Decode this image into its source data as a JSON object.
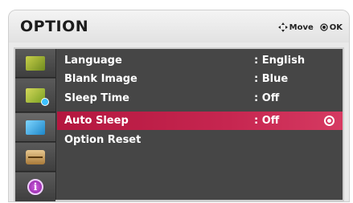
{
  "menu": {
    "title": "OPTION",
    "hints": {
      "move_label": "Move",
      "ok_label": "OK"
    }
  },
  "sidebar": {
    "items": [
      {
        "icon": "picture-icon",
        "color": "#8fa82a"
      },
      {
        "icon": "picture-settings-icon",
        "color": "#9bbf30"
      },
      {
        "icon": "screen-icon",
        "color": "#3aa9e0"
      },
      {
        "icon": "toolbox-icon",
        "color": "#c8a060"
      },
      {
        "icon": "info-icon",
        "color": "#b040c0"
      }
    ]
  },
  "options": [
    {
      "label": "Language",
      "value": ": English",
      "selected": false
    },
    {
      "label": "Blank Image",
      "value": ": Blue",
      "selected": false
    },
    {
      "label": "Sleep Time",
      "value": ": Off",
      "selected": false
    },
    {
      "label": "Auto Sleep",
      "value": ": Off",
      "selected": true
    },
    {
      "label": "Option Reset",
      "value": "",
      "selected": false
    }
  ],
  "colors": {
    "accent": "#c62650",
    "panel_bg": "#464646"
  }
}
